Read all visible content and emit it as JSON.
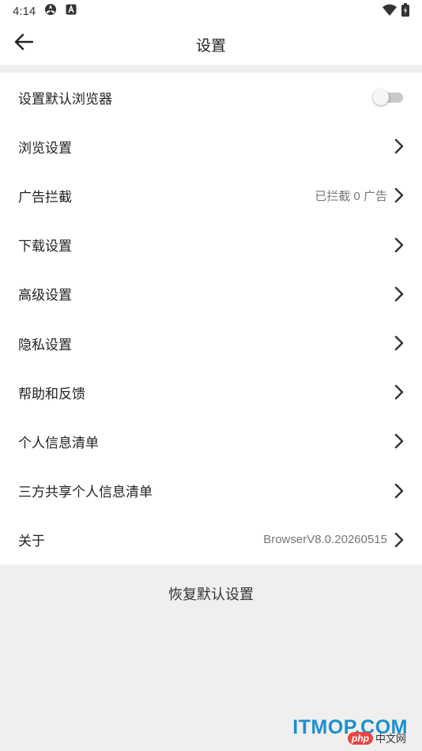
{
  "status_bar": {
    "time": "4:14",
    "left_icons": [
      "settings-gear-icon",
      "a-notification-icon"
    ],
    "right_icons": [
      "wifi-icon",
      "battery-icon"
    ]
  },
  "app_bar": {
    "back_icon": "arrow-left-icon",
    "title": "设置"
  },
  "settings_list": [
    {
      "label": "设置默认浏览器",
      "value": "",
      "control": "toggle",
      "toggle_on": false
    },
    {
      "label": "浏览设置",
      "value": "",
      "control": "chevron"
    },
    {
      "label": "广告拦截",
      "value": "已拦截 0 广告",
      "control": "chevron"
    },
    {
      "label": "下载设置",
      "value": "",
      "control": "chevron"
    },
    {
      "label": "高级设置",
      "value": "",
      "control": "chevron"
    },
    {
      "label": "隐私设置",
      "value": "",
      "control": "chevron"
    },
    {
      "label": "帮助和反馈",
      "value": "",
      "control": "chevron"
    },
    {
      "label": "个人信息清单",
      "value": "",
      "control": "chevron"
    },
    {
      "label": "三方共享个人信息清单",
      "value": "",
      "control": "chevron"
    },
    {
      "label": "关于",
      "value": "BrowserV8.0.20260515",
      "control": "chevron"
    }
  ],
  "restore_label": "恢复默认设置",
  "watermark": {
    "main": "ITMOP.COM",
    "badge": "php",
    "cn": "中文网"
  },
  "colors": {
    "background": "#efefef",
    "surface": "#ffffff",
    "text": "#222222",
    "secondary_text": "#777777",
    "toggle_off_track": "#c9c9c9",
    "watermark_blue": "#1b8fcf",
    "watermark_red": "#e94545"
  }
}
